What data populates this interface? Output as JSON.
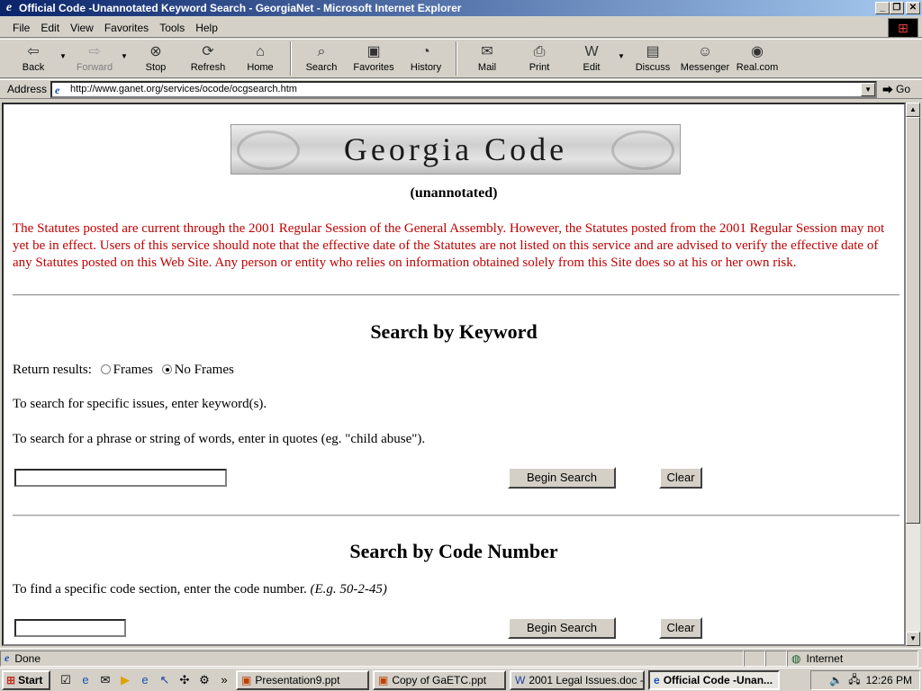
{
  "window": {
    "title": "Official Code -Unannotated Keyword Search - GeorgiaNet - Microsoft Internet Explorer"
  },
  "menu": [
    "File",
    "Edit",
    "View",
    "Favorites",
    "Tools",
    "Help"
  ],
  "toolbar": {
    "back": "Back",
    "forward": "Forward",
    "stop": "Stop",
    "refresh": "Refresh",
    "home": "Home",
    "search": "Search",
    "favorites": "Favorites",
    "history": "History",
    "mail": "Mail",
    "print": "Print",
    "edit": "Edit",
    "discuss": "Discuss",
    "messenger": "Messenger",
    "realcom": "Real.com"
  },
  "address": {
    "label": "Address",
    "url": "http://www.ganet.org/services/ocode/ocgsearch.htm",
    "go": "Go"
  },
  "page": {
    "banner": "Georgia Code",
    "subtitle": "(unannotated)",
    "notice": "The Statutes posted are current through the 2001 Regular Session of the General Assembly. However, the Statutes posted from the 2001 Regular Session may not yet be in effect. Users of this service should note that the effective date of the Statutes are not listed on this service and are advised to verify the effective date of any Statutes posted on this Web Site. Any person or entity who relies on information obtained solely from this Site does so at his or her own risk.",
    "keyword": {
      "heading": "Search by Keyword",
      "return_label": "Return results:",
      "frames": "Frames",
      "no_frames": "No Frames",
      "instr1": "To search for specific issues, enter keyword(s).",
      "instr2": "To search for a phrase or string of words, enter in quotes (eg. \"child abuse\").",
      "input_value": "",
      "begin": "Begin Search",
      "clear": "Clear"
    },
    "code": {
      "heading": "Search by Code Number",
      "instr": "To find a specific code section, enter the code number.",
      "example": "(E.g. 50-2-45)",
      "input_value": "",
      "begin": "Begin Search",
      "clear": "Clear"
    }
  },
  "status": {
    "text": "Done",
    "zone": "Internet"
  },
  "taskbar": {
    "start": "Start",
    "tasks": [
      "Presentation9.ppt",
      "Copy of GaETC.ppt",
      "2001 Legal Issues.doc - ...",
      "Official Code -Unan..."
    ],
    "clock": "12:26 PM"
  }
}
